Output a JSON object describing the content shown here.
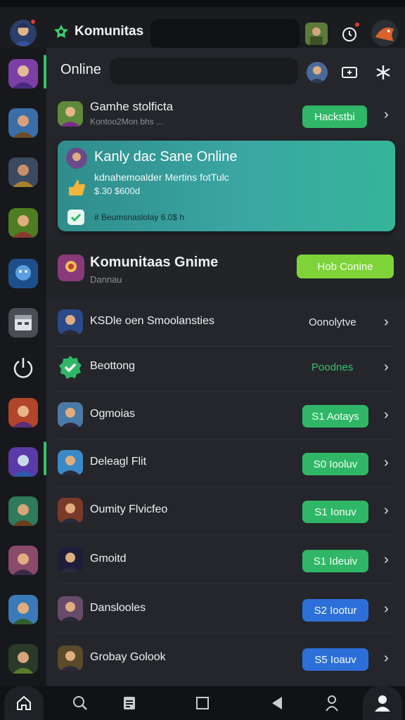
{
  "status_bar": {
    "left": "",
    "right": ""
  },
  "header": {
    "brand_title": "Komunitas",
    "search_placeholder": ""
  },
  "online": {
    "label": "Online",
    "search_placeholder": ""
  },
  "top_item": {
    "title": "Gamhe stolficta",
    "subtitle": "Kontoo2Mon bhs ...",
    "pill": "Hackstbi"
  },
  "feature_card": {
    "title": "Kanly dac Sane Online",
    "line1": "kdnahemoalder Mertins fotTulc",
    "line2": "$.30 $600d",
    "footer": "# Beumsnaslolay 6.0$ h"
  },
  "community": {
    "title": "Komunitaas Gnime",
    "subtitle": "Dannau",
    "button": "Hob Conine"
  },
  "list": [
    {
      "title": "KSDle oen Smoolansties",
      "action": "Oonolytve"
    },
    {
      "title": "Beottong",
      "action": "Poodnes"
    },
    {
      "title": "Ogmoias",
      "pill": "S1 Aotays"
    },
    {
      "title": "Deleagl Flit",
      "pill": "S0 Iooluv"
    },
    {
      "title": "Oumity Flvicfeo",
      "pill": "S1 Ionuv"
    },
    {
      "title": "Gmoitd",
      "pill": "S1 Ideuiv"
    },
    {
      "title": "Danslooles",
      "pill": "S2 Iootur"
    },
    {
      "title": "Grobay Golook",
      "pill": "S5 Ioauv"
    }
  ],
  "colors": {
    "accent_green": "#37c16b",
    "lime": "#7ed339",
    "blue": "#2d6fd8",
    "teal_card": "#3aa6a2"
  },
  "icons": [
    "home-icon",
    "search-icon",
    "notes-icon",
    "square-icon",
    "back-icon",
    "friends-icon",
    "profile-icon"
  ]
}
